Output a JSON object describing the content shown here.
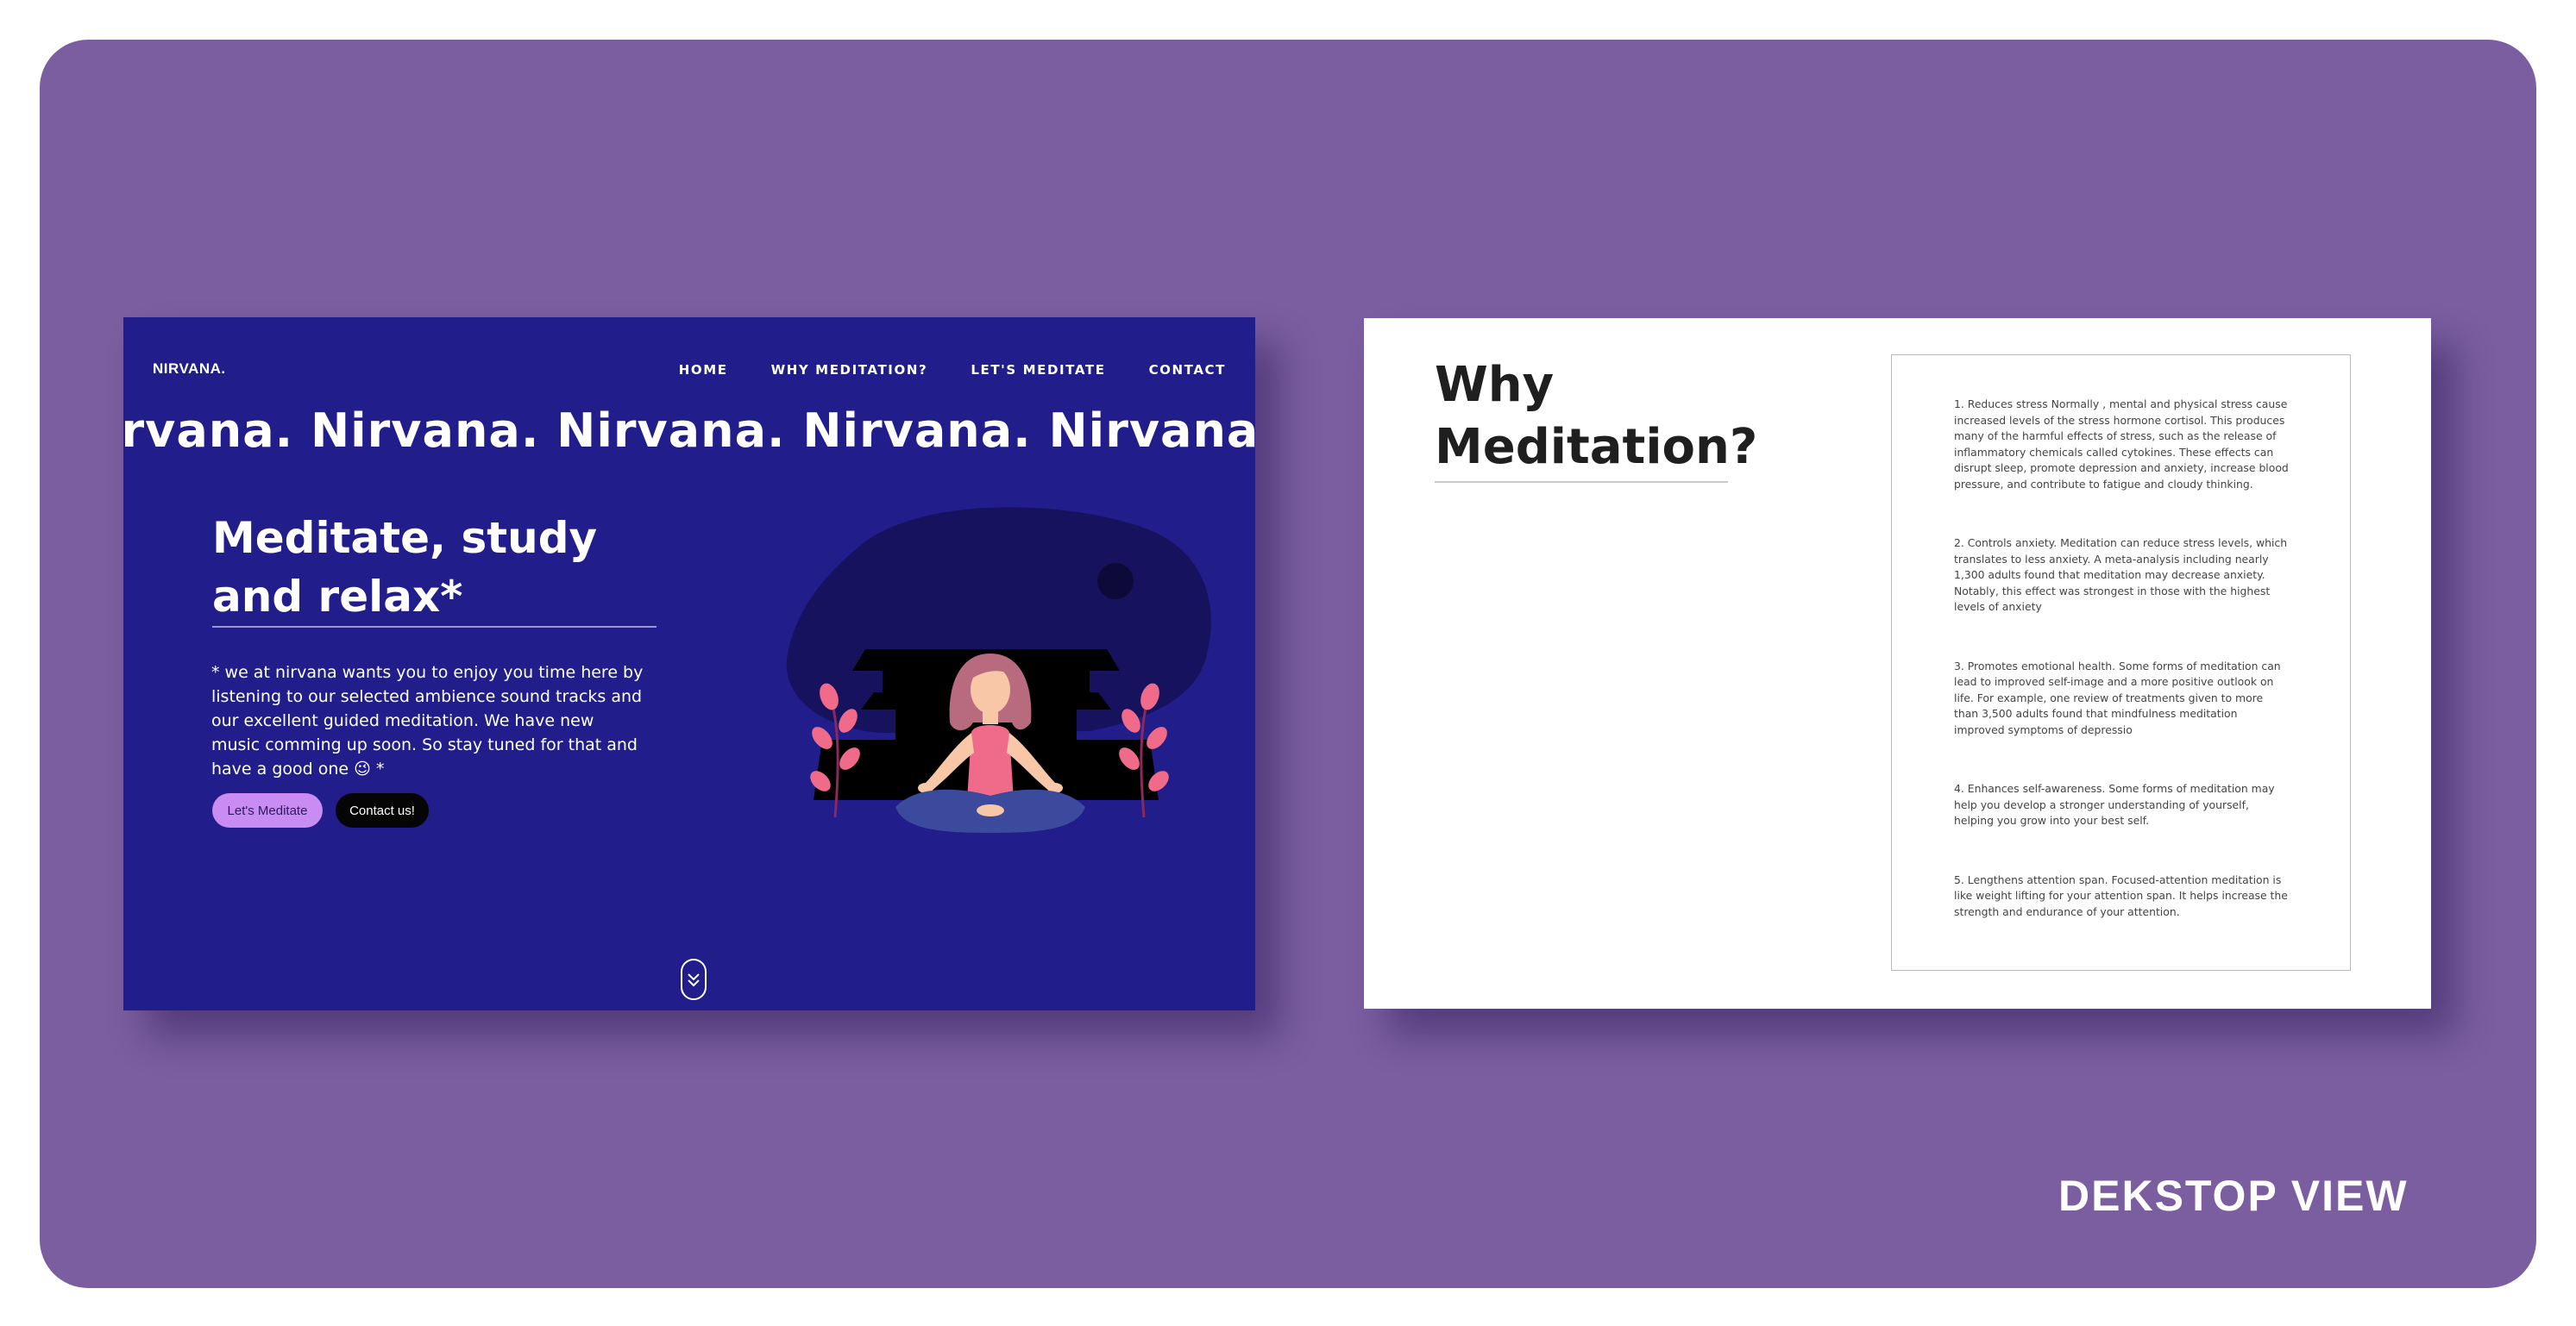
{
  "hero": {
    "logo": "NIRVANA.",
    "nav": [
      "HOME",
      "WHY MEDITATION?",
      "LET'S MEDITATE",
      "CONTACT"
    ],
    "marquee": "irvana. Nirvana. Nirvana. Nirvana. Nirvana. N",
    "title_line1": "Meditate, study",
    "title_line2": "and relax*",
    "text": "* we at nirvana wants you to enjoy you time here by listening to our selected ambience sound tracks and our excellent guided meditation. We have new music comming up soon. So stay tuned for that and have a good one 😉 *",
    "btn_meditate": "Let's Meditate",
    "btn_contact": "Contact us!",
    "scroll_icon": "double-chevron-down-icon"
  },
  "why": {
    "title_line1": "Why",
    "title_line2": "Meditation?",
    "benefits": [
      "1. Reduces stress Normally , mental and physical stress cause increased levels of the stress hormone cortisol. This produces many of the harmful effects of stress, such as the release of inflammatory chemicals called cytokines. These effects can disrupt sleep, promote depression and anxiety, increase blood pressure, and contribute to fatigue and cloudy thinking.",
      "2. Controls anxiety. Meditation can reduce stress levels, which translates to less anxiety. A meta-analysis including nearly 1,300 adults found that meditation may decrease anxiety. Notably, this effect was strongest in those with the highest levels of anxiety",
      "3. Promotes emotional health. Some forms of meditation can lead to improved self-image and a more positive outlook on life. For example, one review of treatments given to more than 3,500 adults found that mindfulness meditation improved symptoms of depressio",
      "4. Enhances self-awareness. Some forms of meditation may help you develop a stronger understanding of yourself, helping you grow into your best self.",
      "5. Lengthens attention span. Focused-attention meditation is like weight lifting for your attention span. It helps increase the strength and endurance of your attention."
    ]
  },
  "caption": "DEKSTOP VIEW",
  "colors": {
    "board": "#7a5ea0",
    "hero_bg": "#211d8a",
    "accent_button": "#c88cf2",
    "blob": "#17125e",
    "figure_top": "#f06b8a",
    "figure_legs": "#3b4a9c"
  }
}
